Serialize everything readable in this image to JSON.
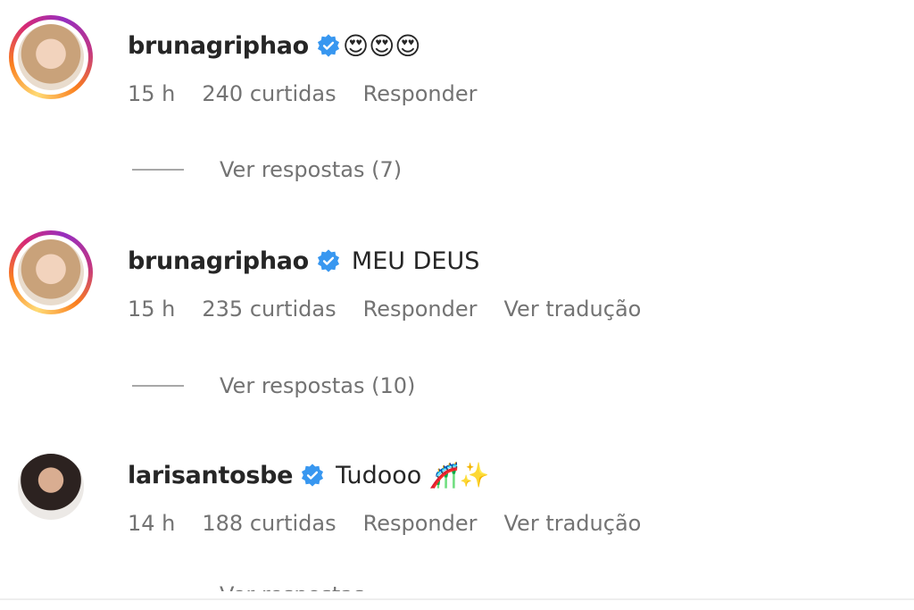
{
  "comments": [
    {
      "username": "brunagriphao",
      "text": "😍😍😍",
      "time": "15 h",
      "likes": "240 curtidas",
      "reply": "Responder",
      "translate": "",
      "view_replies": "Ver respostas (7)",
      "avatar_icon": "profile-photo-blonde",
      "story_ring": true
    },
    {
      "username": "brunagriphao",
      "text": "MEU DEUS",
      "time": "15 h",
      "likes": "235 curtidas",
      "reply": "Responder",
      "translate": "Ver tradução",
      "view_replies": "Ver respostas (10)",
      "avatar_icon": "profile-photo-blonde",
      "story_ring": true
    },
    {
      "username": "larisantosbe",
      "text": "Tudooo 🎢✨",
      "time": "14 h",
      "likes": "188 curtidas",
      "reply": "Responder",
      "translate": "Ver tradução",
      "view_replies": "Ver respostas",
      "avatar_icon": "profile-photo-brunette",
      "story_ring": false
    }
  ],
  "colors": {
    "primary_text": "#262626",
    "secondary_text": "#737373",
    "verified_badge": "#3897f0"
  }
}
